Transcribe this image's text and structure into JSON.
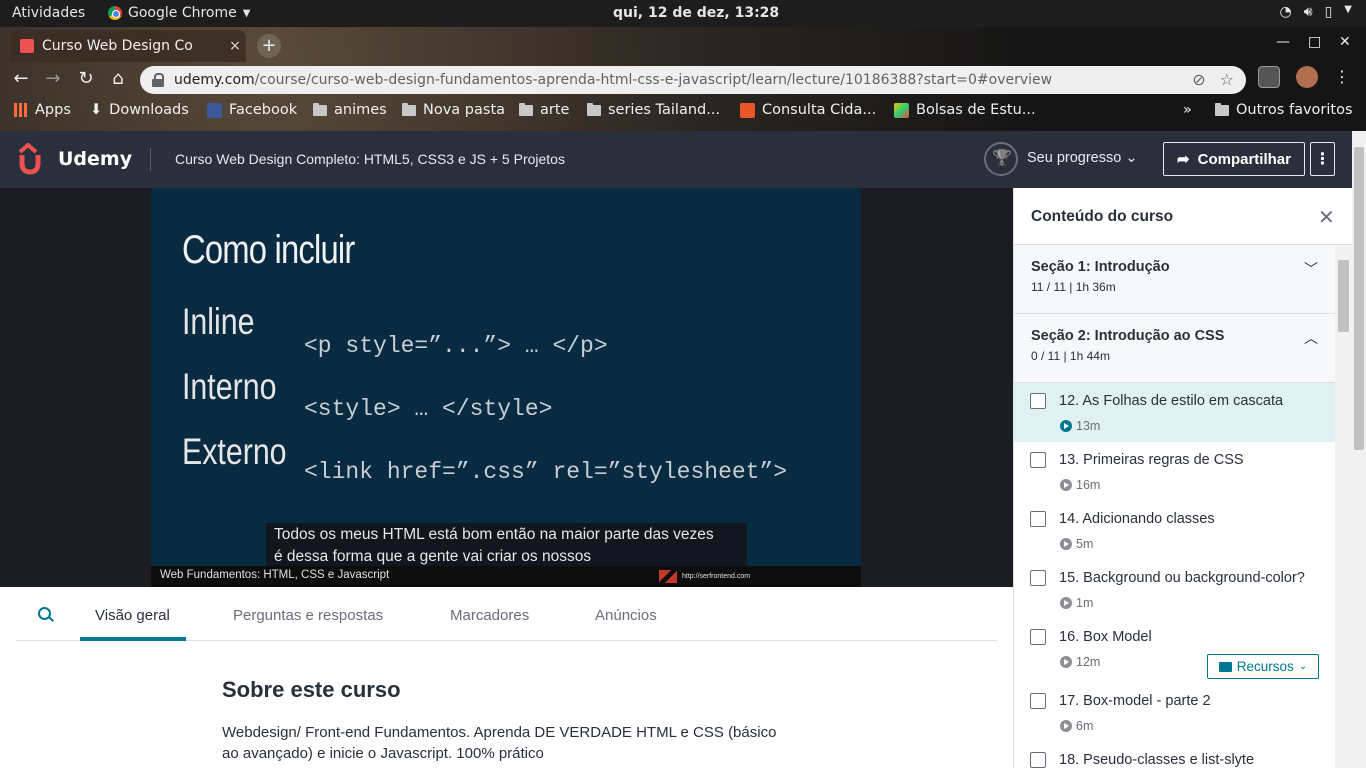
{
  "system": {
    "activities": "Atividades",
    "app_name": "Google Chrome",
    "clock": "qui, 12 de dez, 13:28"
  },
  "browser": {
    "tab_title": "Curso Web Design Co",
    "tab_close": "×",
    "new_tab": "+",
    "url_host": "udemy.com",
    "url_path": "/course/curso-web-design-fundamentos-aprenda-html-css-e-javascript/learn/lecture/10186388?start=0#overview",
    "bookmarks": [
      {
        "label": "Apps"
      },
      {
        "label": "Downloads"
      },
      {
        "label": "Facebook"
      },
      {
        "label": "animes"
      },
      {
        "label": "Nova pasta"
      },
      {
        "label": "arte"
      },
      {
        "label": "series Tailand..."
      },
      {
        "label": "Consulta Cida..."
      },
      {
        "label": "Bolsas de Estu..."
      }
    ],
    "bookmarks_overflow": "»",
    "other_bookmarks": "Outros favoritos"
  },
  "header": {
    "brand": "Udemy",
    "course_title": "Curso Web Design Completo: HTML5, CSS3 e JS + 5 Projetos",
    "progress_label": "Seu progresso",
    "share_label": "Compartilhar",
    "more": "⋮"
  },
  "video": {
    "slide_title": "Como incluir",
    "terms": [
      "Inline",
      "Interno",
      "Externo"
    ],
    "code": [
      "<p style=”...”> … </p>",
      "<style> … </style>",
      "<link href=”.css” rel=”stylesheet”>"
    ],
    "caption_line1": "Todos os meus HTML está bom então na maior parte das vezes",
    "caption_line2": "é dessa forma que a gente vai criar os nossos",
    "footer_left": "Web Fundamentos: HTML, CSS e Javascript",
    "footer_right": "http://serfrontend.com"
  },
  "lower_tabs": {
    "items": [
      "Visão geral",
      "Perguntas e respostas",
      "Marcadores",
      "Anúncios"
    ],
    "active": "Visão geral"
  },
  "about": {
    "title": "Sobre este curso",
    "text": "Webdesign/ Front-end Fundamentos. Aprenda DE VERDADE HTML e CSS (básico ao avançado) e inicie o Javascript. 100% prático"
  },
  "sidebar": {
    "title": "Conteúdo do curso",
    "close": "✕",
    "sections": [
      {
        "title": "Seção 1: Introdução",
        "meta": "11 / 11 | 1h 36m",
        "chevron": "﹀"
      },
      {
        "title": "Seção 2: Introdução ao CSS",
        "meta": "0 / 11 | 1h 44m",
        "chevron": "︿"
      }
    ],
    "lectures": [
      {
        "title": "12. As Folhas de estilo em cascata",
        "duration": "13m"
      },
      {
        "title": "13. Primeiras regras de CSS",
        "duration": "16m"
      },
      {
        "title": "14. Adicionando classes",
        "duration": "5m"
      },
      {
        "title": "15. Background ou background-color?",
        "duration": "1m"
      },
      {
        "title": "16. Box Model",
        "duration": "12m"
      },
      {
        "title": "17. Box-model - parte 2",
        "duration": "6m"
      },
      {
        "title": "18. Pseudo-classes e list-slyte",
        "duration": ""
      }
    ],
    "resources_label": "Recursos"
  },
  "colors": {
    "udemy_dark": "#29303b",
    "accent_teal": "#007791",
    "brand_red": "#ec5252",
    "active_lecture_bg": "#e0f1f3"
  }
}
